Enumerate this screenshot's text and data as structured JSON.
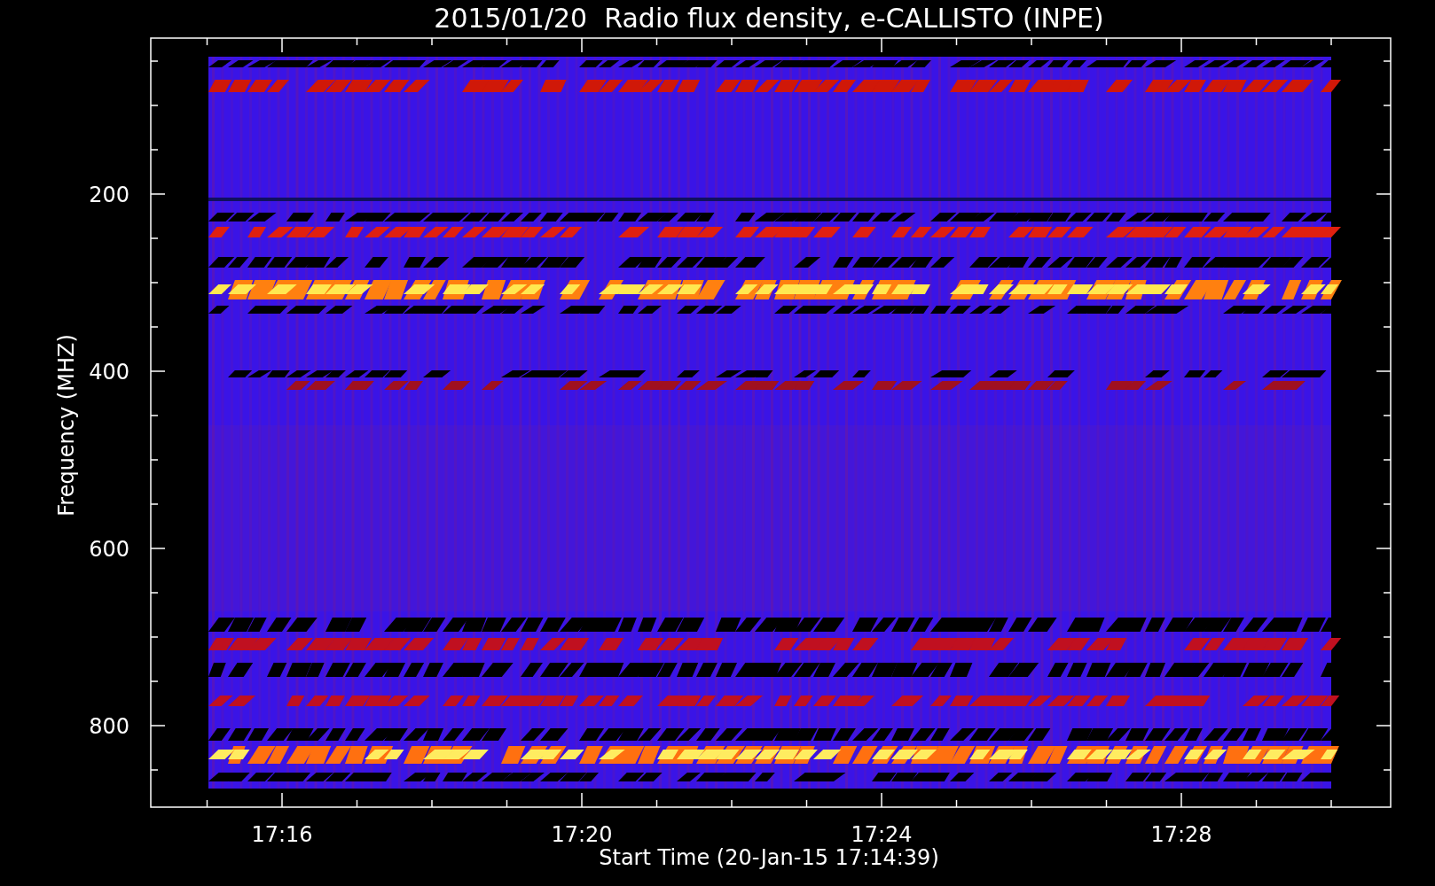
{
  "title": "2015/01/20  Radio flux density, e-CALLISTO (INPE)",
  "y_axis": {
    "label": "Frequency (MHZ)",
    "ticks": [
      "200",
      "400",
      "600",
      "800"
    ]
  },
  "x_axis": {
    "label": "Start Time (20-Jan-15 17:14:39)",
    "ticks": [
      "17:16",
      "17:20",
      "17:24",
      "17:28"
    ]
  }
}
